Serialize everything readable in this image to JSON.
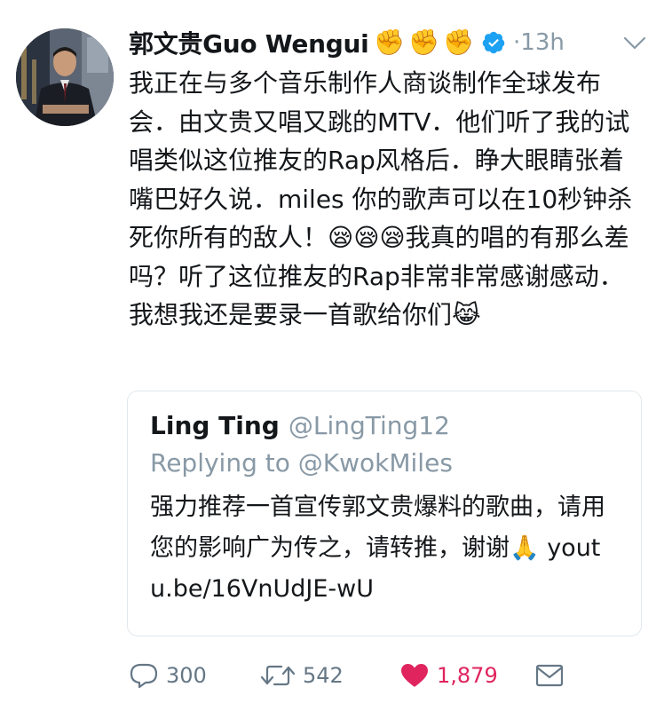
{
  "tweet": {
    "author": {
      "display_name": "郭文贵Guo Wengui",
      "name_emojis": [
        "✊",
        "✊",
        "✊"
      ],
      "verified": true,
      "separator": "·",
      "timestamp": "13h"
    },
    "text": "我正在与多个音乐制作人商谈制作全球发布会．由文贵又唱又跳的MTV．他们听了我的试唱类似这位推友的Rap风格后．睁大眼睛张着嘴巴好久说．miles 你的歌声可以在10秒钟杀死你所有的敌人！😪😪😪我真的唱的有那么差吗？听了这位推友的Rap非常非常感谢感动．我想我还是要录一首歌给你们😹",
    "quoted": {
      "display_name": "Ling Ting",
      "handle": "@LingTing12",
      "replying_label": "Replying to",
      "replying_handle": "@KwokMiles",
      "text": "强力推荐一首宣传郭文贵爆料的歌曲，请用您的影响广为传之，请转推，谢谢🙏 youtu.be/16VnUdJE-wU"
    },
    "actions": {
      "reply_count": "300",
      "retweet_count": "542",
      "like_count": "1,879",
      "liked": true
    }
  },
  "icons": {
    "verified": "verified-badge-icon",
    "caret": "chevron-down-icon",
    "reply": "reply-bubble-icon",
    "retweet": "retweet-icon",
    "like": "heart-icon",
    "dm": "envelope-icon"
  },
  "colors": {
    "verified": "#1da1f2",
    "like": "#e0245e",
    "muted": "#8899a6",
    "text": "#14171a",
    "border": "#e1e8ed"
  }
}
